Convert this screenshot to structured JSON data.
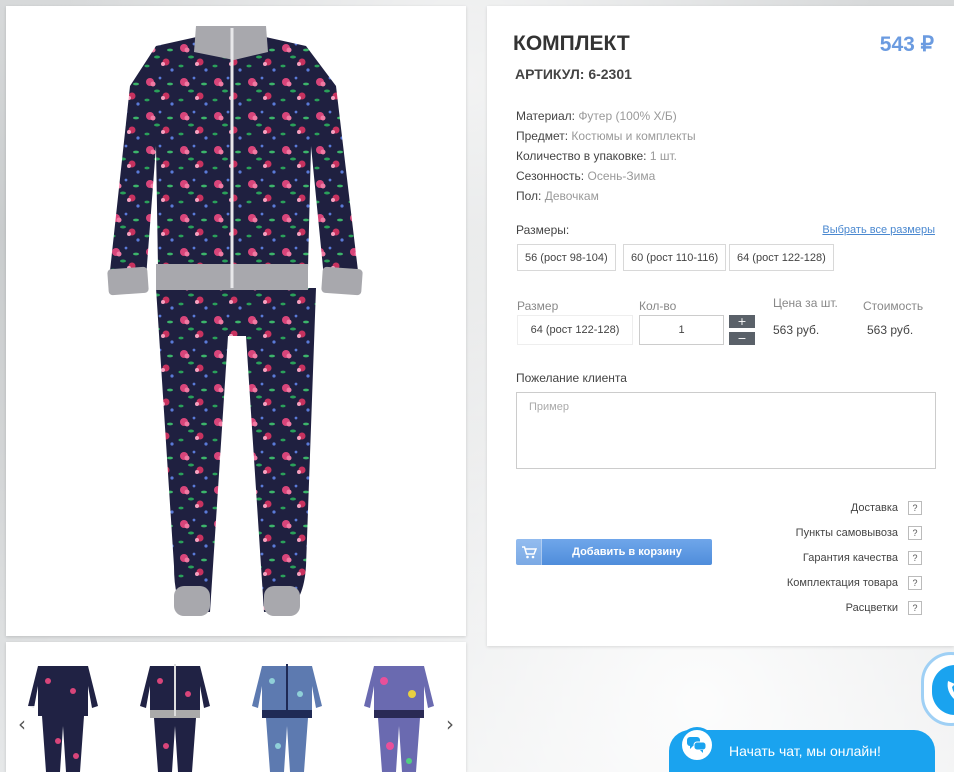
{
  "product": {
    "title": "КОМПЛЕКТ",
    "price": "543 ₽",
    "sku": "АРТИКУЛ: 6-2301"
  },
  "properties": [
    {
      "label": "Материал:",
      "value": "Футер (100% Х/Б)"
    },
    {
      "label": "Предмет:",
      "value": "Костюмы и комплекты"
    },
    {
      "label": "Количество в упаковке:",
      "value": "1 шт."
    },
    {
      "label": "Сезонность:",
      "value": "Осень-Зима"
    },
    {
      "label": "Пол:",
      "value": "Девочкам"
    }
  ],
  "sizes": {
    "label": "Размеры:",
    "select_all": "Выбрать все размеры",
    "options": [
      "56 (рост 98-104)",
      "60 (рост 110-116)",
      "64 (рост 122-128)"
    ]
  },
  "order": {
    "col_size": "Размер",
    "col_qty": "Кол-во",
    "col_unit_price": "Цена за шт.",
    "col_total": "Стоимость",
    "size_value": "64 (рост 122-128)",
    "qty_value": "1",
    "plus": "+",
    "minus": "−",
    "unit_price": "563 руб.",
    "total": "563 руб."
  },
  "wish": {
    "label": "Пожелание клиента",
    "placeholder": "Пример"
  },
  "cart_button": "Добавить в корзину",
  "help_links": [
    "Доставка",
    "Пункты самовывоза",
    "Гарантия качества",
    "Комплектация товара",
    "Расцветки"
  ],
  "help_q": "?",
  "gallery": {
    "prev": "‹",
    "next": "›"
  },
  "chat": {
    "label": "Начать чат, мы онлайн!"
  },
  "colors": {
    "accent": "#6b9be0",
    "chat": "#1aa3ef",
    "button": "#4f8ddb"
  }
}
